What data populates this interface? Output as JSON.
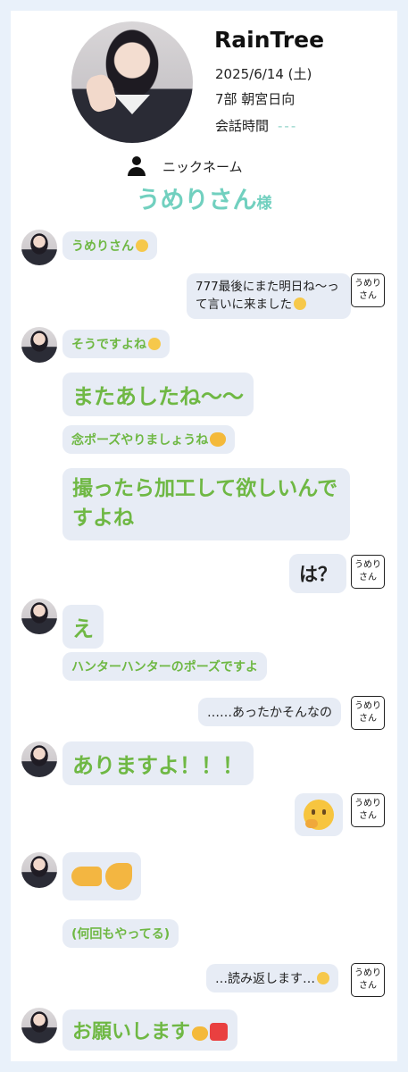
{
  "header": {
    "title": "RainTree",
    "date": "2025/6/14 (土)",
    "part": "7部  朝宮日向",
    "talk_time_label": "会話時間",
    "talk_time_value": "---",
    "nickname_label": "ニックネーム",
    "nickname": "うめりさん",
    "honorific": "様"
  },
  "badge_text": "うめりさん",
  "messages": [
    {
      "from": "idol",
      "text": "うめりさん"
    },
    {
      "from": "fan",
      "text": "777最後にまた明日ね〜って言いに来ました"
    },
    {
      "from": "idol",
      "text": "そうですよね"
    },
    {
      "from": "idol",
      "text": "またあしたね〜〜"
    },
    {
      "from": "idol",
      "text": "念ポーズやりましょうね"
    },
    {
      "from": "idol",
      "text": "撮ったら加工して欲しいんですよね"
    },
    {
      "from": "fan",
      "text": "は？"
    },
    {
      "from": "idol",
      "text": "え"
    },
    {
      "from": "idol",
      "text": "ハンターハンターのポーズですよ"
    },
    {
      "from": "fan",
      "text": "……あったかそんなの"
    },
    {
      "from": "idol",
      "text": "ありますよ！！！"
    },
    {
      "from": "fan",
      "text": ""
    },
    {
      "from": "idol",
      "text": ""
    },
    {
      "from": "idol",
      "text": "(何回もやってる)"
    },
    {
      "from": "fan",
      "text": "…読み返します…"
    },
    {
      "from": "idol",
      "text": "お願いします"
    }
  ],
  "colors": {
    "accent": "#71d0bf",
    "idol_text": "#6fb844",
    "bubble_bg": "#e7ecf5",
    "page_bg": "#e9f1fa"
  },
  "icons": [
    "person-icon",
    "thinking-face-emoji",
    "smiling-face-emoji",
    "cat-face-emoji",
    "pleading-face-emoji",
    "angry-cat-emoji",
    "anger-symbol-emoji",
    "pointing-hand-emoji"
  ]
}
